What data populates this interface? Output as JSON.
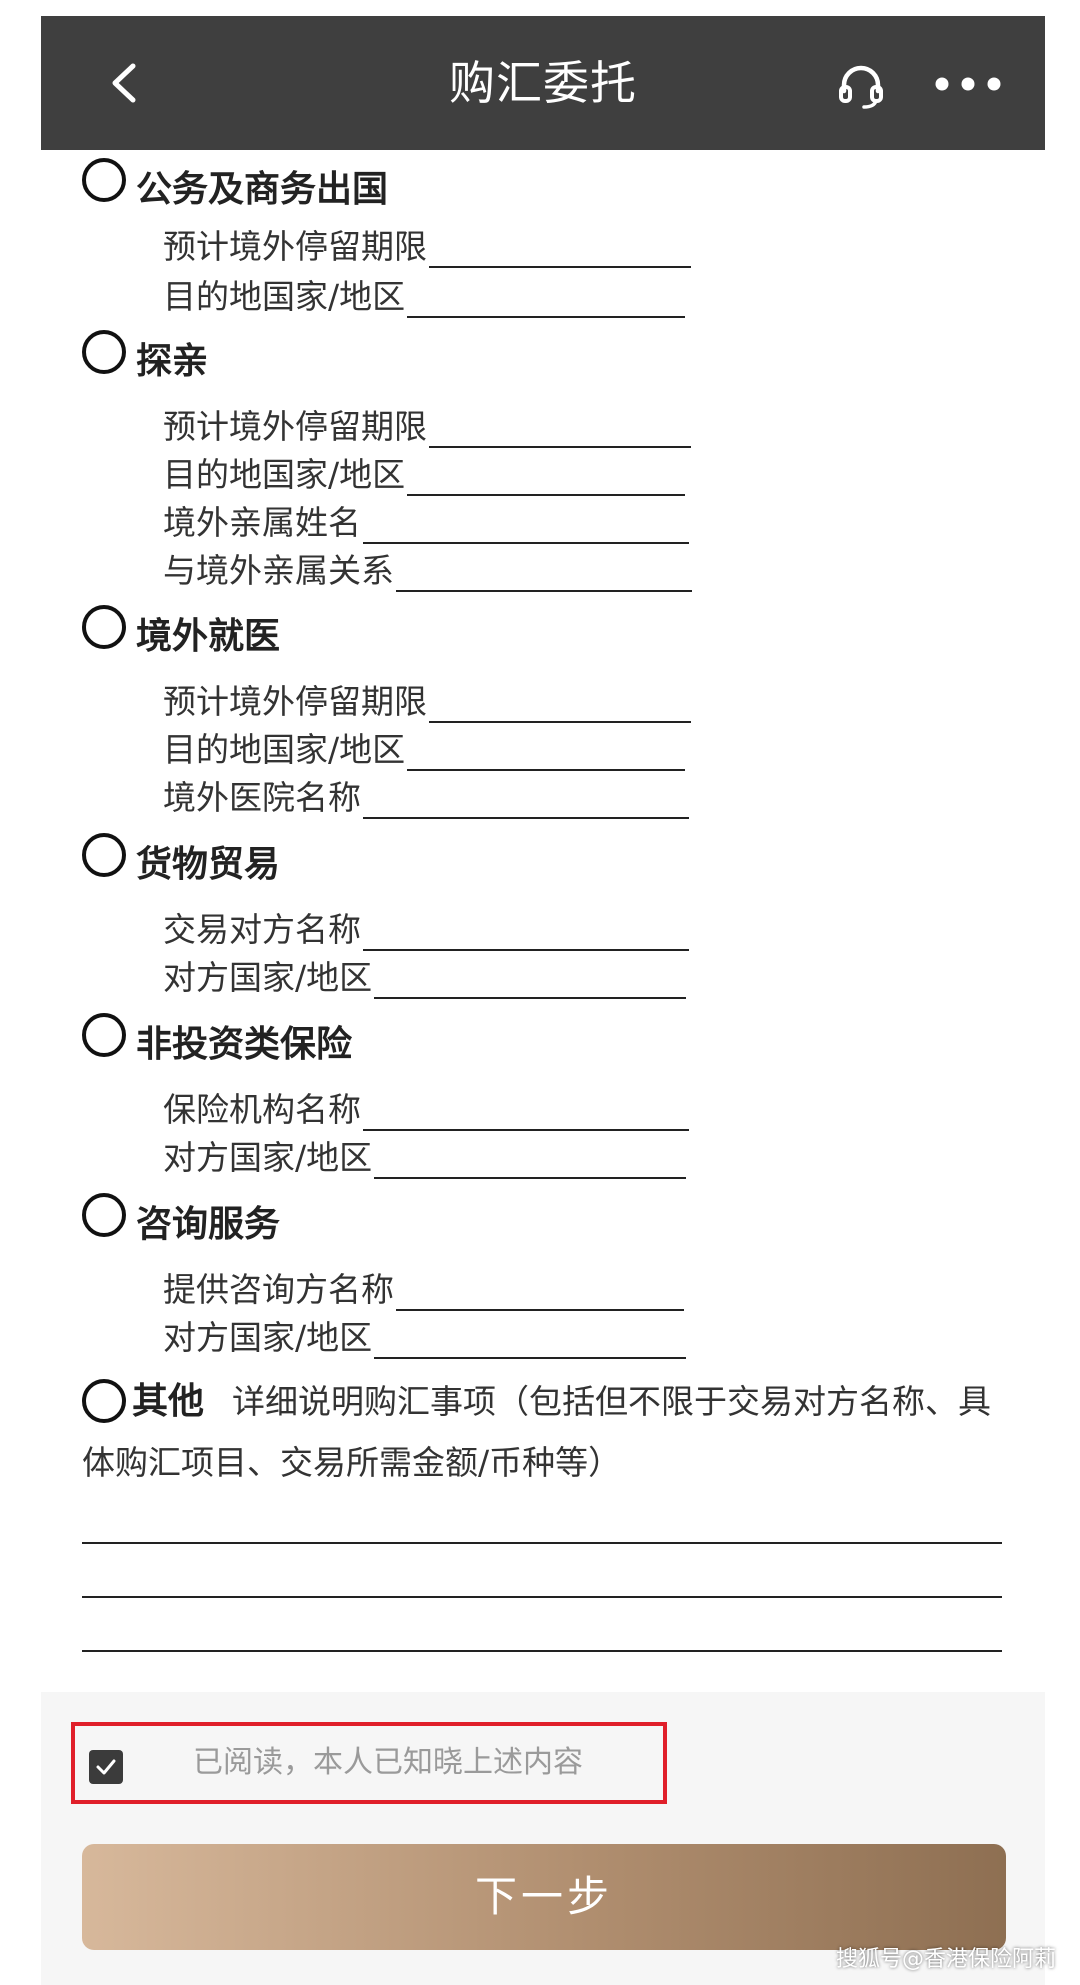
{
  "header": {
    "title": "购汇委托",
    "back_icon": "chevron-left-icon",
    "support_icon": "headset-icon",
    "more_icon": "more-dots-icon",
    "background": "#3f3f3f"
  },
  "sections": [
    {
      "title": "公务及商务出国",
      "fields": [
        "预计境外停留期限",
        "目的地国家/地区"
      ]
    },
    {
      "title": "探亲",
      "fields": [
        "预计境外停留期限",
        "目的地国家/地区",
        "境外亲属姓名",
        "与境外亲属关系"
      ]
    },
    {
      "title": "境外就医",
      "fields": [
        "预计境外停留期限",
        "目的地国家/地区",
        "境外医院名称"
      ]
    },
    {
      "title": "货物贸易",
      "fields": [
        "交易对方名称",
        "对方国家/地区"
      ]
    },
    {
      "title": "非投资类保险",
      "fields": [
        "保险机构名称",
        "对方国家/地区"
      ]
    },
    {
      "title": "咨询服务",
      "fields": [
        "提供咨询方名称",
        "对方国家/地区"
      ]
    }
  ],
  "other": {
    "title": "其他",
    "description": "详细说明购汇事项（包括但不限于交易对方名称、具体购汇项目、交易所需金额/币种等）"
  },
  "agreement": {
    "label": "已阅读，本人已知晓上述内容",
    "checked": true,
    "highlight_color": "#e01f2a"
  },
  "next_button": {
    "label": "下一步"
  },
  "watermark": "搜狐号@香港保险阿莉"
}
